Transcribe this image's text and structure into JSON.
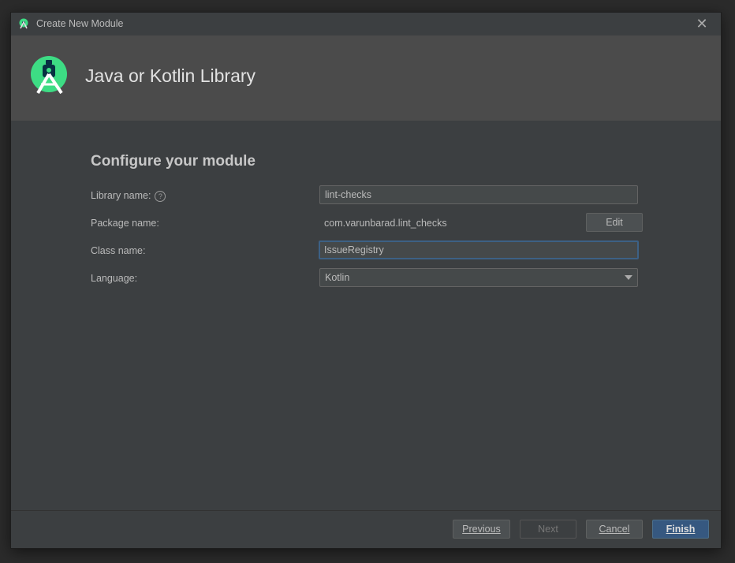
{
  "window": {
    "title": "Create New Module",
    "close_icon": "close-icon"
  },
  "header": {
    "heading": "Java or Kotlin Library",
    "logo_icon": "android-studio-icon"
  },
  "form": {
    "section_title": "Configure your module",
    "library_name": {
      "label": "Library name:",
      "value": "lint-checks",
      "help_icon": "help-icon"
    },
    "package_name": {
      "label": "Package name:",
      "value": "com.varunbarad.lint_checks",
      "edit_label": "Edit"
    },
    "class_name": {
      "label": "Class name:",
      "value": "IssueRegistry"
    },
    "language": {
      "label": "Language:",
      "value": "Kotlin",
      "dropdown_icon": "chevron-down-icon"
    }
  },
  "footer": {
    "previous_label": "Previous",
    "next_label": "Next",
    "cancel_label": "Cancel",
    "finish_label": "Finish"
  },
  "colors": {
    "accent": "#365880",
    "focus_border": "#3d6185",
    "logo_green": "#3ddc84"
  }
}
